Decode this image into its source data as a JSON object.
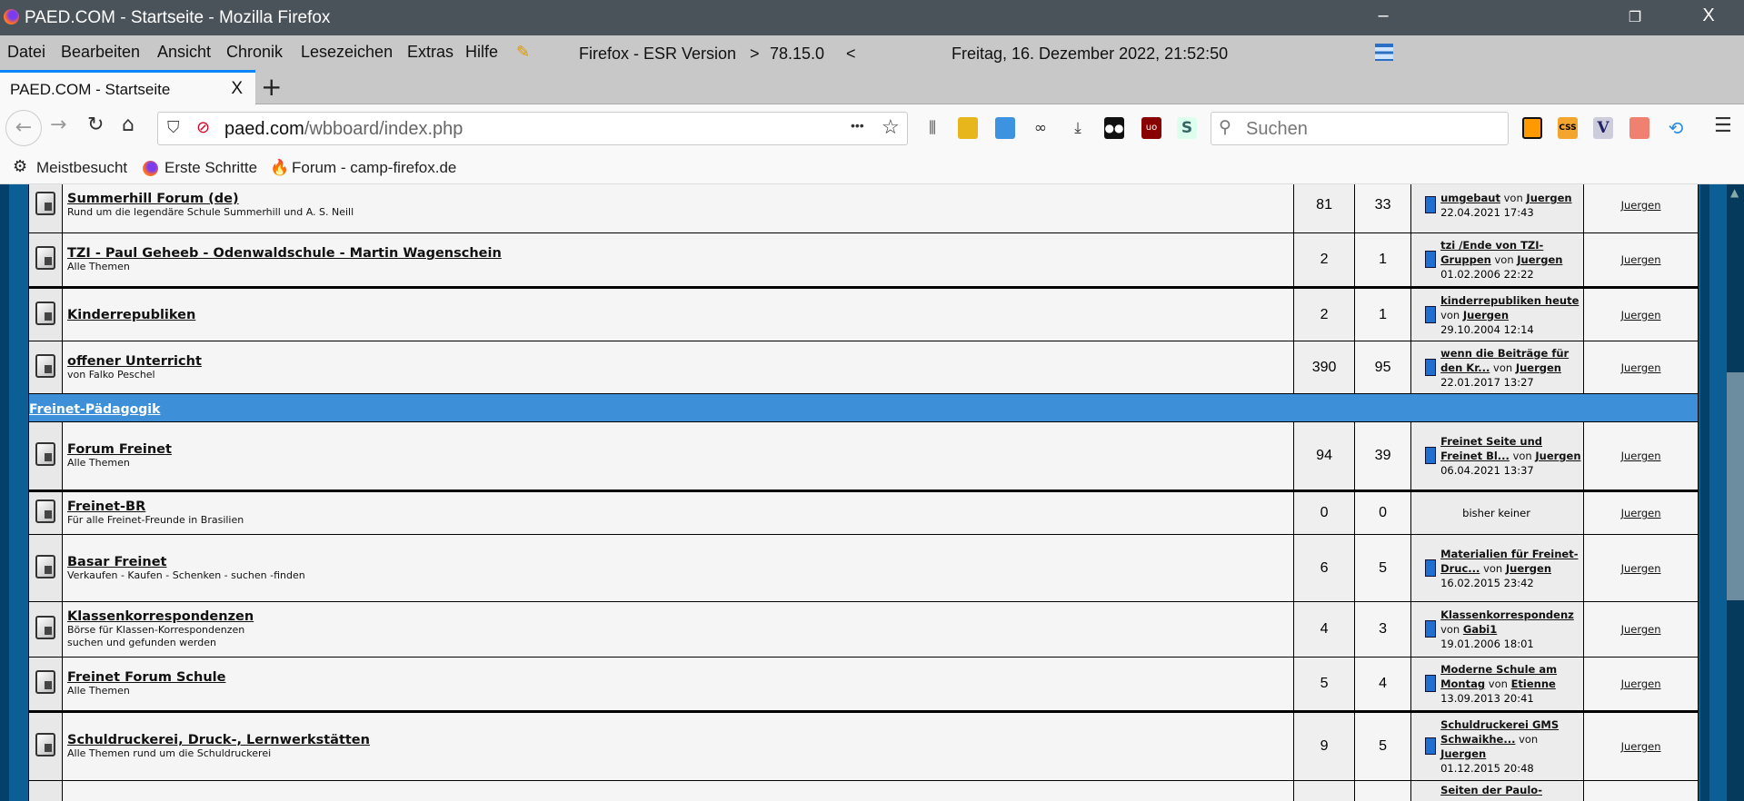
{
  "window": {
    "title": "PAED.COM - Startseite - Mozilla Firefox",
    "minimize": "–",
    "restore": "❐",
    "close": "X"
  },
  "menu": {
    "items": [
      "Datei",
      "Bearbeiten",
      "Ansicht",
      "Chronik",
      "Lesezeichen",
      "Extras",
      "Hilfe"
    ],
    "version_label": "Firefox - ESR Version",
    "version_arrow_right": ">",
    "version": "78.15.0",
    "version_arrow_left": "<",
    "datetime": "Freitag, 16. Dezember 2022, 21:52:50"
  },
  "tab": {
    "label": "PAED.COM - Startseite",
    "close": "X",
    "new": "+"
  },
  "nav": {
    "url_host": "paed.com",
    "url_path": "/wbboard/index.php",
    "more": "•••",
    "search_placeholder": "Suchen",
    "menu": "☰"
  },
  "bookmarks": [
    "Meistbesucht",
    "Erste Schritte",
    "Forum - camp-firefox.de"
  ],
  "forum": {
    "by": "von",
    "rows": [
      {
        "type": "forum",
        "title": "Summerhill Forum (de)",
        "desc": [
          "Rund um die legendäre Schule Summerhill und A. S. Neill"
        ],
        "posts": "81",
        "threads": "33",
        "last_title": "umgebaut",
        "last_user": "Juergen",
        "last_date": "22.04.2021 17:43",
        "moderator": "Juergen"
      },
      {
        "type": "forum",
        "title": "TZI - Paul Geheeb - Odenwaldschule - Martin Wagenschein",
        "desc": [
          "Alle Themen"
        ],
        "posts": "2",
        "threads": "1",
        "last_title": "tzi /Ende von TZI-Gruppen",
        "last_user": "Juergen",
        "last_date": "01.02.2006 22:22",
        "moderator": "Juergen"
      },
      {
        "type": "forum",
        "title": "Kinderrepubliken",
        "desc": [],
        "posts": "2",
        "threads": "1",
        "last_title": "kinderrepubliken heute",
        "last_user": "Juergen",
        "last_date": "29.10.2004 12:14",
        "moderator": "Juergen"
      },
      {
        "type": "forum",
        "title": "offener Unterricht",
        "desc": [
          "von Falko Peschel"
        ],
        "posts": "390",
        "threads": "95",
        "last_title": "wenn die Beiträge für den Kr...",
        "last_user": "Juergen",
        "last_date": "22.01.2017 13:27",
        "moderator": "Juergen"
      },
      {
        "type": "category",
        "title": "Freinet-Pädagogik"
      },
      {
        "type": "forum",
        "title": "Forum Freinet",
        "desc": [
          "Alle Themen"
        ],
        "posts": "94",
        "threads": "39",
        "last_title": "Freinet Seite und Freinet Bl...",
        "last_user": "Juergen",
        "last_date": "06.04.2021 13:37",
        "moderator": "Juergen"
      },
      {
        "type": "forum",
        "title": "Freinet-BR",
        "desc": [
          "Für alle Freinet-Freunde in Brasilien"
        ],
        "posts": "0",
        "threads": "0",
        "last_none": "bisher keiner",
        "moderator": "Juergen"
      },
      {
        "type": "forum",
        "title": "Basar Freinet",
        "desc": [
          "Verkaufen - Kaufen - Schenken - suchen -finden"
        ],
        "posts": "6",
        "threads": "5",
        "last_title": "Materialien für Freinet-Druc...",
        "last_user": "Juergen",
        "last_date": "16.02.2015 23:42",
        "moderator": "Juergen"
      },
      {
        "type": "forum",
        "title": "Klassenkorrespondenzen",
        "desc": [
          "Börse für Klassen-Korrespondenzen",
          "suchen und gefunden werden"
        ],
        "posts": "4",
        "threads": "3",
        "last_title": "Klassenkorrespondenz",
        "last_user": "Gabi1",
        "last_date": "19.01.2006 18:01",
        "moderator": "Juergen"
      },
      {
        "type": "forum",
        "title": "Freinet Forum Schule",
        "desc": [
          "Alle Themen"
        ],
        "posts": "5",
        "threads": "4",
        "last_title": "Moderne Schule am Montag",
        "last_user": "Etienne",
        "last_date": "13.09.2013 20:41",
        "moderator": "Juergen"
      },
      {
        "type": "forum",
        "title": "Schuldruckerei, Druck-, Lernwerkstätten",
        "desc": [
          "Alle Themen rund um die Schuldruckerei"
        ],
        "posts": "9",
        "threads": "5",
        "last_title": "Schuldruckerei GMS Schwaikhe...",
        "last_user": "Juergen",
        "last_date": "01.12.2015 20:48",
        "moderator": "Juergen"
      },
      {
        "type": "forum_partial",
        "last_title": "Seiten der Paulo-"
      }
    ]
  }
}
